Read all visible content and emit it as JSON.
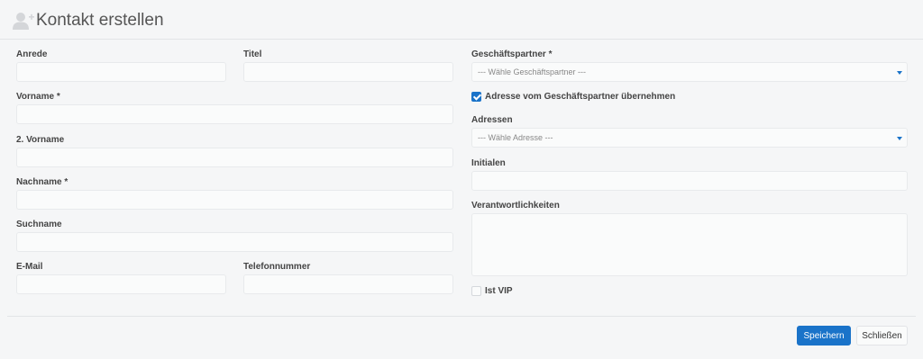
{
  "header": {
    "title": "Kontakt erstellen",
    "icon": "add-user-icon"
  },
  "left": {
    "anrede": {
      "label": "Anrede",
      "value": ""
    },
    "titel": {
      "label": "Titel",
      "value": ""
    },
    "vorname": {
      "label": "Vorname *",
      "value": ""
    },
    "vorname2": {
      "label": "2. Vorname",
      "value": ""
    },
    "nachname": {
      "label": "Nachname *",
      "value": ""
    },
    "suchname": {
      "label": "Suchname",
      "value": ""
    },
    "email": {
      "label": "E-Mail",
      "value": ""
    },
    "telefon": {
      "label": "Telefonnummer",
      "value": ""
    }
  },
  "right": {
    "partner": {
      "label": "Geschäftspartner *",
      "placeholder": "--- Wähle Geschäftspartner ---"
    },
    "adresse_check": {
      "label": "Adresse vom Geschäftspartner übernehmen",
      "checked": true
    },
    "adressen": {
      "label": "Adressen",
      "placeholder": "--- Wähle Adresse ---"
    },
    "initialen": {
      "label": "Initialen",
      "value": ""
    },
    "verantwortlichkeiten": {
      "label": "Verantwortlichkeiten",
      "value": ""
    },
    "vip": {
      "label": "Ist VIP",
      "checked": false
    }
  },
  "footer": {
    "save_label": "Speichern",
    "close_label": "Schließen"
  },
  "colors": {
    "accent": "#1a73c9",
    "background": "#f5f6f7"
  }
}
